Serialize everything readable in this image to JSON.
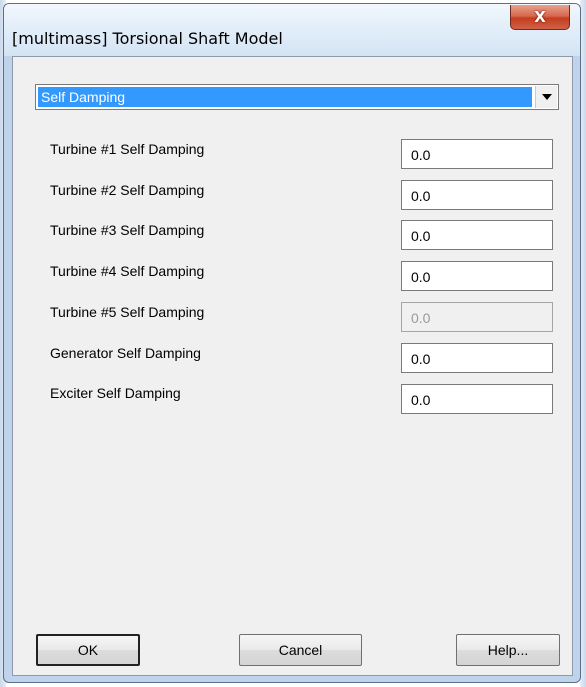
{
  "window": {
    "title": "[multimass] Torsional Shaft Model",
    "close_label": "X"
  },
  "dropdown": {
    "selected": "Self Damping",
    "icon": "triangle-down-icon"
  },
  "fields": [
    {
      "label": "Turbine #1 Self Damping",
      "value": "0.0",
      "enabled": true
    },
    {
      "label": "Turbine #2 Self Damping",
      "value": "0.0",
      "enabled": true
    },
    {
      "label": "Turbine #3 Self Damping",
      "value": "0.0",
      "enabled": true
    },
    {
      "label": "Turbine #4 Self Damping",
      "value": "0.0",
      "enabled": true
    },
    {
      "label": "Turbine #5 Self Damping",
      "value": "0.0",
      "enabled": false
    },
    {
      "label": "Generator Self Damping",
      "value": "0.0",
      "enabled": true
    },
    {
      "label": "Exciter Self Damping",
      "value": "0.0",
      "enabled": true
    }
  ],
  "buttons": {
    "ok": "OK",
    "cancel": "Cancel",
    "help": "Help..."
  },
  "colors": {
    "selection": "#3399ff",
    "close_button": "#c43e1e",
    "panel": "#f0f0f0"
  }
}
